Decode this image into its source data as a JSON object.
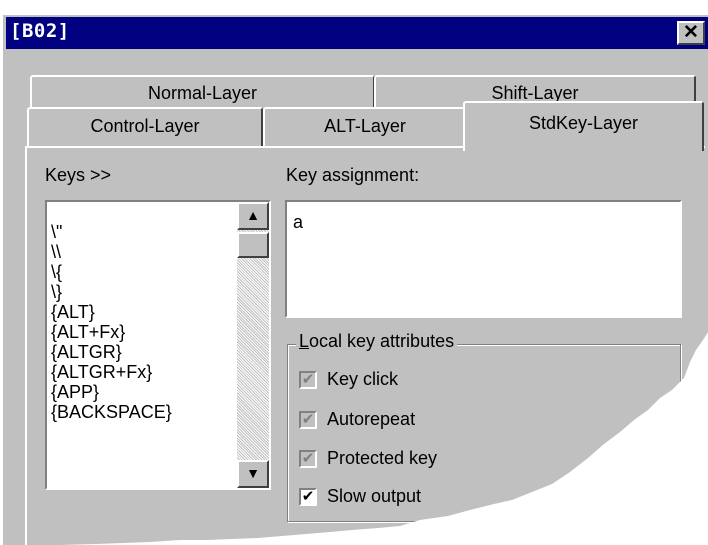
{
  "window": {
    "title": "[B02]",
    "close_glyph": "✕"
  },
  "tabs_row1": [
    {
      "label": "Normal-Layer"
    },
    {
      "label": "Shift-Layer"
    }
  ],
  "tabs_row2": [
    {
      "label": "Control-Layer"
    },
    {
      "label": "ALT-Layer"
    },
    {
      "label": "StdKey-Layer",
      "active": true
    }
  ],
  "keys": {
    "label": "Keys >>",
    "items": [
      "\\\"",
      "\\\\",
      "\\{",
      "\\}",
      "{ALT}",
      "{ALT+Fx}",
      "{ALTGR}",
      "{ALTGR+Fx}",
      "{APP}",
      "{BACKSPACE}"
    ]
  },
  "assignment": {
    "label": "Key assignment:",
    "value": "a"
  },
  "attributes": {
    "group_label": "Local key attributes",
    "options": [
      {
        "label": "Key click",
        "checked": true,
        "enabled": false
      },
      {
        "label": "Autorepeat",
        "checked": true,
        "enabled": false
      },
      {
        "label": "Protected key",
        "checked": true,
        "enabled": false
      },
      {
        "label": "Slow output",
        "checked": true,
        "enabled": true
      }
    ]
  },
  "colors": {
    "titlebar": "#000080",
    "face": "#c0c0c0"
  }
}
